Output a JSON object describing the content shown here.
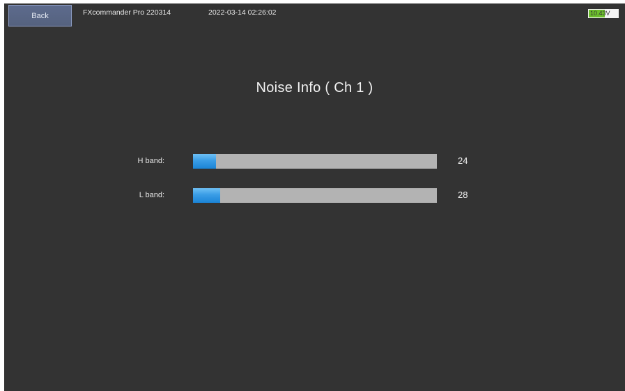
{
  "header": {
    "back_label": "Back",
    "app_name": "FXcommander Pro 220314",
    "datetime": "2022-03-14 02:26:02",
    "battery_voltage": "10.43V",
    "battery_level": 0.55
  },
  "page": {
    "title": "Noise Info ( Ch  1 )"
  },
  "bands": [
    {
      "label": "H band:",
      "value": "24",
      "fill_fraction": 0.095
    },
    {
      "label": "L band:",
      "value": "28",
      "fill_fraction": 0.11
    }
  ],
  "colors": {
    "background": "#333333",
    "bar_track": "#b3b3b3",
    "bar_fill": "#3a9de6",
    "battery_fill": "#6cbf2c"
  }
}
